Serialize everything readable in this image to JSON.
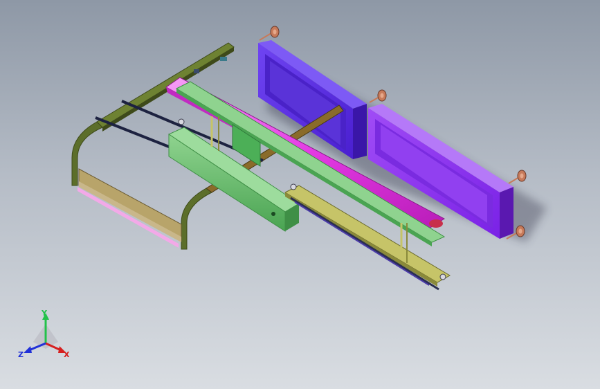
{
  "viewport": {
    "background_top": "#8e98a6",
    "background_bottom": "#d9dde2"
  },
  "colors": {
    "frame_olive": "#5c6e2a",
    "frame_olive_dark": "#3e4a1a",
    "rail_magenta": "#e43be4",
    "rail_light": "#f58af5",
    "beam_green": "#6fbd72",
    "beam_green_dark": "#3f8f46",
    "box_blue": "#5b2de2",
    "box_violet": "#8a2ef0",
    "tan_plate": "#b8a46a",
    "pink_strip": "#f3a9e8",
    "dark_rod": "#1d2240",
    "bolt_copper": "#c77a5a",
    "crossbar_brown": "#8a6b2a"
  },
  "triad": {
    "y_label": "Y",
    "x_label": "X",
    "z_label": "Z",
    "y_color": "#22c24a",
    "x_color": "#d62020",
    "z_color": "#2030d8"
  }
}
